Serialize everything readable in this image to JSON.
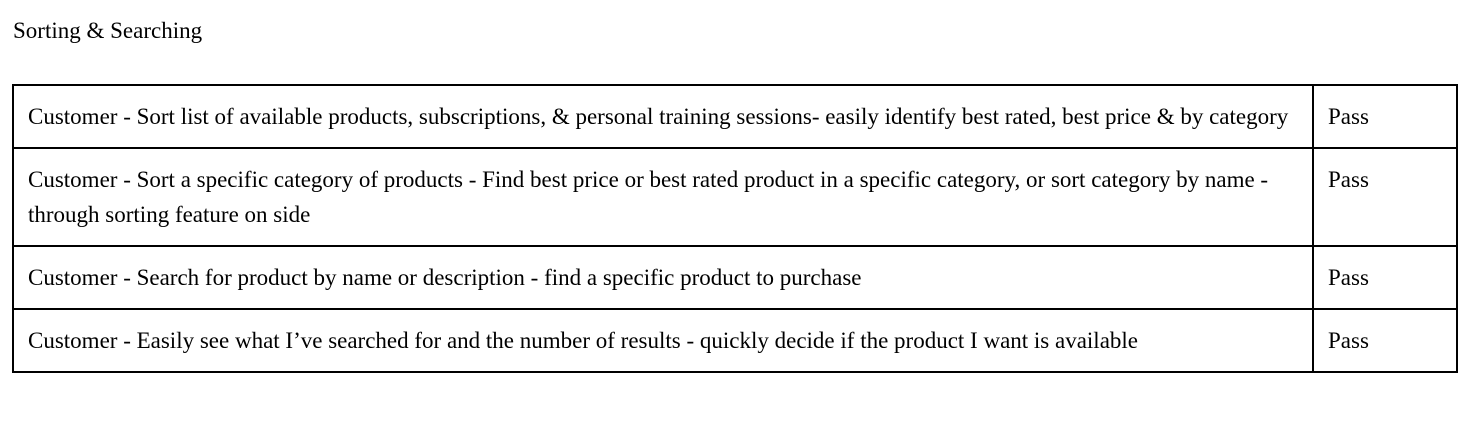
{
  "document": {
    "heading": "Sorting & Searching",
    "rows": [
      {
        "description": "Customer - Sort list of available products, subscriptions, & personal training sessions- easily identify best rated, best price & by category",
        "status": "Pass"
      },
      {
        "description": "Customer - Sort a specific category of products  - Find best price or best rated product in a specific category, or sort category by name - through sorting feature on side",
        "status": "Pass"
      },
      {
        "description": "Customer - Search for product by name or description - find a specific product to purchase",
        "status": "Pass"
      },
      {
        "description": "Customer - Easily see what I’ve searched for and the number of results - quickly decide if the product I want is available",
        "status": "Pass"
      }
    ]
  }
}
